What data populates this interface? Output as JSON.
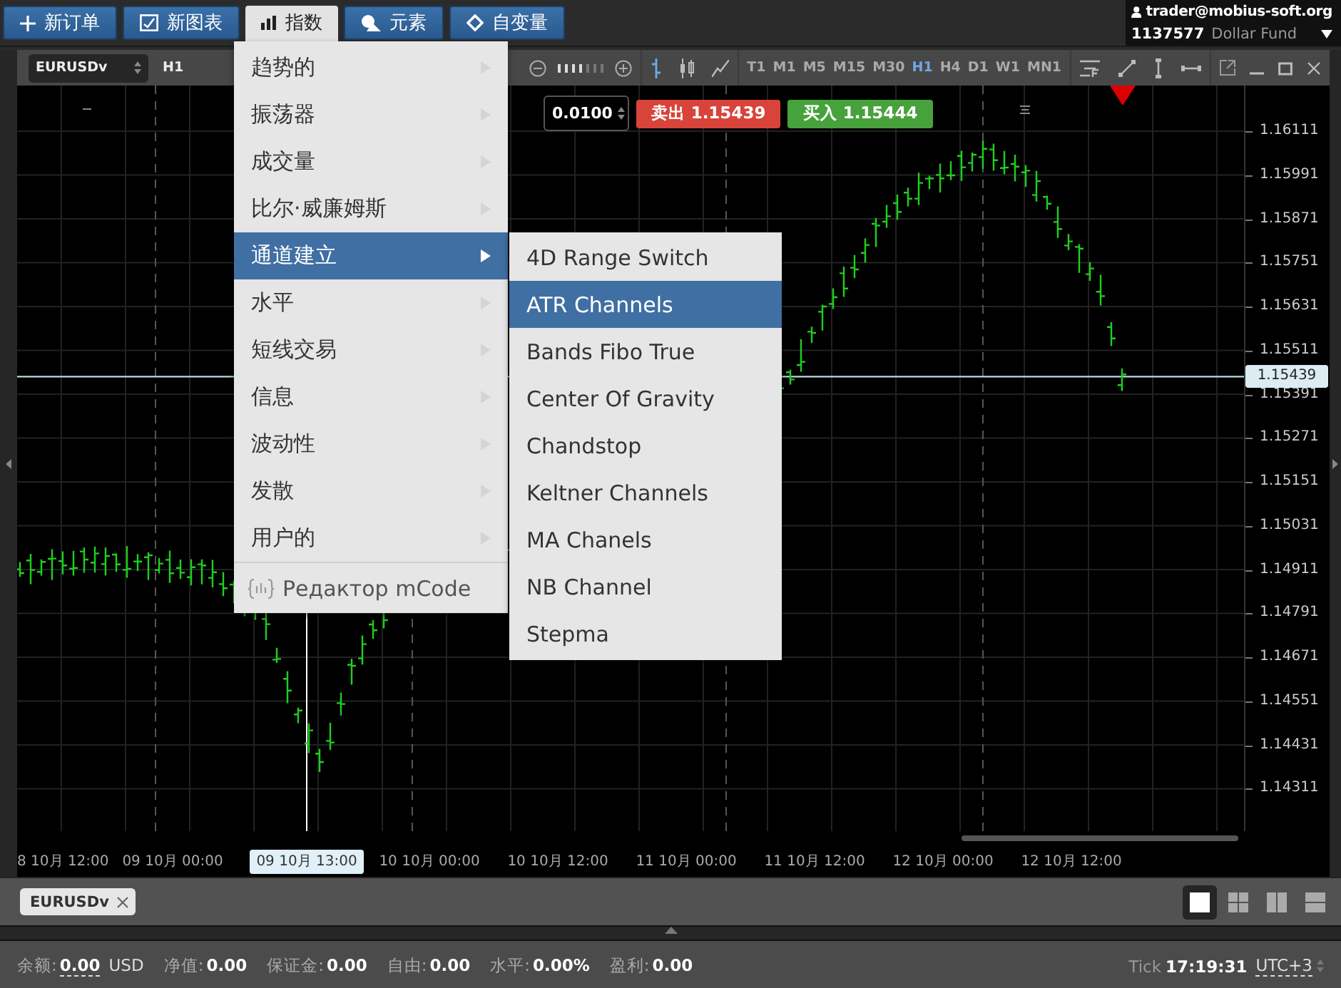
{
  "top_buttons": [
    {
      "label": "新订单",
      "selected": false
    },
    {
      "label": "新图表",
      "selected": false
    },
    {
      "label": "指数",
      "selected": true
    },
    {
      "label": "元素",
      "selected": false
    },
    {
      "label": "自变量",
      "selected": false
    }
  ],
  "account": {
    "email": "trader@mobius-soft.org",
    "number": "1137577",
    "name": "Dollar Fund"
  },
  "chart_toolbar": {
    "symbol": "EURUSDv",
    "period": "H1",
    "timeframes": [
      {
        "label": "T1",
        "selected": false
      },
      {
        "label": "M1",
        "selected": false
      },
      {
        "label": "M5",
        "selected": false
      },
      {
        "label": "M15",
        "selected": false
      },
      {
        "label": "M30",
        "selected": false
      },
      {
        "label": "H1",
        "selected": true
      },
      {
        "label": "H4",
        "selected": false
      },
      {
        "label": "D1",
        "selected": false
      },
      {
        "label": "W1",
        "selected": false
      },
      {
        "label": "MN1",
        "selected": false
      }
    ]
  },
  "trade_panel": {
    "lot": "0.0100",
    "sell_label": "卖出",
    "sell_price": "1.15439",
    "buy_label": "买入",
    "buy_price": "1.15444"
  },
  "price_axis": [
    "1.16111",
    "1.15991",
    "1.15871",
    "1.15751",
    "1.15631",
    "1.15511",
    "1.15391",
    "1.15271",
    "1.15151",
    "1.15031",
    "1.14911",
    "1.14791",
    "1.14671",
    "1.14551",
    "1.14431",
    "1.14311"
  ],
  "current_price": "1.15439",
  "time_axis": [
    "8 10月 12:00",
    "09 10月 00:00",
    "10 10月 00:00",
    "10 10月 12:00",
    "11 10月 00:00",
    "11 10月 12:00",
    "12 10月 00:00",
    "12 10月 12:00"
  ],
  "crosshair_time": "09 10月 13:00",
  "menu": {
    "items": [
      {
        "label": "趋势的",
        "selected": false
      },
      {
        "label": "振荡器",
        "selected": false
      },
      {
        "label": "成交量",
        "selected": false
      },
      {
        "label": "比尔·威廉姆斯",
        "selected": false
      },
      {
        "label": "通道建立",
        "selected": true
      },
      {
        "label": "水平",
        "selected": false
      },
      {
        "label": "短线交易",
        "selected": false
      },
      {
        "label": "信息",
        "selected": false
      },
      {
        "label": "波动性",
        "selected": false
      },
      {
        "label": "发散",
        "selected": false
      },
      {
        "label": "用户的",
        "selected": false
      }
    ],
    "editor": "Редактор mCode"
  },
  "submenu": {
    "items": [
      {
        "label": "4D Range Switch",
        "selected": false
      },
      {
        "label": "ATR Channels",
        "selected": true
      },
      {
        "label": "Bands Fibo True",
        "selected": false
      },
      {
        "label": "Center Of Gravity",
        "selected": false
      },
      {
        "label": "Chandstop",
        "selected": false
      },
      {
        "label": "Keltner Channels",
        "selected": false
      },
      {
        "label": "MA Chanels",
        "selected": false
      },
      {
        "label": "NB Channel",
        "selected": false
      },
      {
        "label": "Stepma",
        "selected": false
      }
    ]
  },
  "chart_tabs": [
    {
      "label": "EURUSDv"
    }
  ],
  "layout_buttons": [
    {
      "selected": true
    },
    {
      "selected": false
    },
    {
      "selected": false
    },
    {
      "selected": false
    }
  ],
  "status_bar": {
    "fields": [
      {
        "label": "余额:",
        "value": "0.00",
        "unit": "USD"
      },
      {
        "label": "净值:",
        "value": "0.00"
      },
      {
        "label": "保证金:",
        "value": "0.00"
      },
      {
        "label": "自由:",
        "value": "0.00"
      },
      {
        "label": "水平:",
        "value": "0.00%"
      },
      {
        "label": "盈利:",
        "value": "0.00"
      }
    ],
    "tick_label": "Tick",
    "time": "17:19:31",
    "timezone": "UTC+3"
  }
}
